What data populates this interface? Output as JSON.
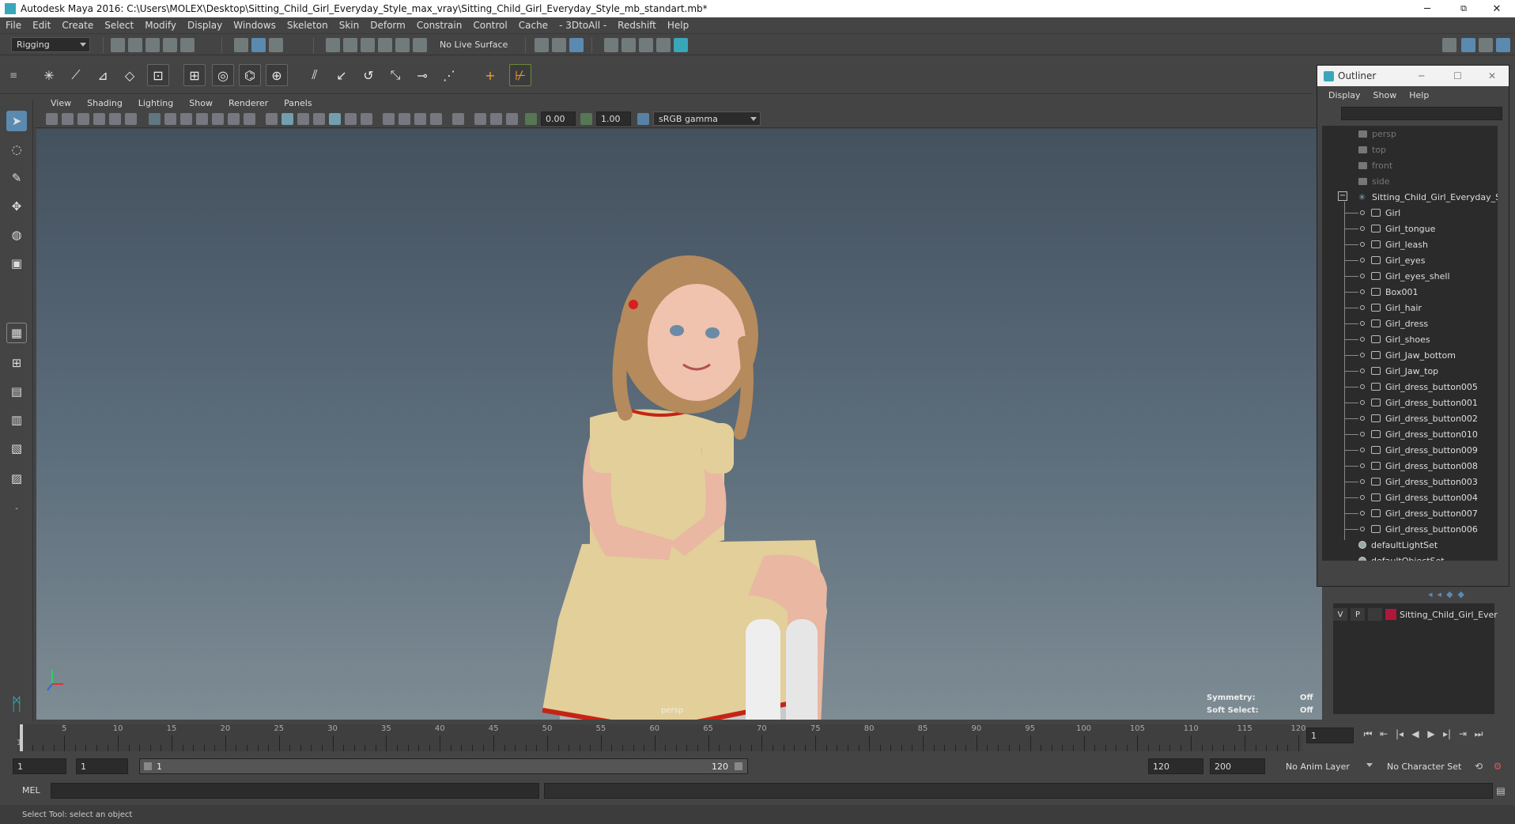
{
  "window": {
    "title": "Autodesk Maya 2016: C:\\Users\\MOLEX\\Desktop\\Sitting_Child_Girl_Everyday_Style_max_vray\\Sitting_Child_Girl_Everyday_Style_mb_standart.mb*",
    "controls": {
      "minimize": "─",
      "maximize": "⧉",
      "close": "✕"
    }
  },
  "menubar": {
    "items": [
      "File",
      "Edit",
      "Create",
      "Select",
      "Modify",
      "Display",
      "Windows",
      "Skeleton",
      "Skin",
      "Deform",
      "Constrain",
      "Control",
      "Cache",
      "- 3DtoAll -",
      "Redshift",
      "Help"
    ]
  },
  "statusline": {
    "menuset": "Rigging",
    "live_surface": "No Live Surface"
  },
  "viewport": {
    "panel_menu": [
      "View",
      "Shading",
      "Lighting",
      "Show",
      "Renderer",
      "Panels"
    ],
    "exposure": "0.00",
    "gamma": "1.00",
    "color_space": "sRGB gamma",
    "camera_label": "persp",
    "hud": {
      "symmetry_label": "Symmetry:",
      "symmetry_value": "Off",
      "soft_select_label": "Soft Select:",
      "soft_select_value": "Off"
    }
  },
  "outliner": {
    "title": "Outliner",
    "menu": [
      "Display",
      "Show",
      "Help"
    ],
    "items": [
      {
        "label": "persp",
        "kind": "camera",
        "dim": true,
        "level": 1
      },
      {
        "label": "top",
        "kind": "camera",
        "dim": true,
        "level": 1
      },
      {
        "label": "front",
        "kind": "camera",
        "dim": true,
        "level": 1
      },
      {
        "label": "side",
        "kind": "camera",
        "dim": true,
        "level": 1
      },
      {
        "label": "Sitting_Child_Girl_Everyday_Styl",
        "kind": "group",
        "dim": false,
        "level": 1
      },
      {
        "label": "Girl",
        "kind": "mesh",
        "dim": false,
        "level": 2
      },
      {
        "label": "Girl_tongue",
        "kind": "mesh",
        "dim": false,
        "level": 2
      },
      {
        "label": "Girl_leash",
        "kind": "mesh",
        "dim": false,
        "level": 2
      },
      {
        "label": "Girl_eyes",
        "kind": "mesh",
        "dim": false,
        "level": 2
      },
      {
        "label": "Girl_eyes_shell",
        "kind": "mesh",
        "dim": false,
        "level": 2
      },
      {
        "label": "Box001",
        "kind": "mesh",
        "dim": false,
        "level": 2
      },
      {
        "label": "Girl_hair",
        "kind": "mesh",
        "dim": false,
        "level": 2
      },
      {
        "label": "Girl_dress",
        "kind": "mesh",
        "dim": false,
        "level": 2
      },
      {
        "label": "Girl_shoes",
        "kind": "mesh",
        "dim": false,
        "level": 2
      },
      {
        "label": "Girl_Jaw_bottom",
        "kind": "mesh",
        "dim": false,
        "level": 2
      },
      {
        "label": "Girl_Jaw_top",
        "kind": "mesh",
        "dim": false,
        "level": 2
      },
      {
        "label": "Girl_dress_button005",
        "kind": "mesh",
        "dim": false,
        "level": 2
      },
      {
        "label": "Girl_dress_button001",
        "kind": "mesh",
        "dim": false,
        "level": 2
      },
      {
        "label": "Girl_dress_button002",
        "kind": "mesh",
        "dim": false,
        "level": 2
      },
      {
        "label": "Girl_dress_button010",
        "kind": "mesh",
        "dim": false,
        "level": 2
      },
      {
        "label": "Girl_dress_button009",
        "kind": "mesh",
        "dim": false,
        "level": 2
      },
      {
        "label": "Girl_dress_button008",
        "kind": "mesh",
        "dim": false,
        "level": 2
      },
      {
        "label": "Girl_dress_button003",
        "kind": "mesh",
        "dim": false,
        "level": 2
      },
      {
        "label": "Girl_dress_button004",
        "kind": "mesh",
        "dim": false,
        "level": 2
      },
      {
        "label": "Girl_dress_button007",
        "kind": "mesh",
        "dim": false,
        "level": 2
      },
      {
        "label": "Girl_dress_button006",
        "kind": "mesh",
        "dim": false,
        "level": 2
      },
      {
        "label": "defaultLightSet",
        "kind": "set",
        "dim": false,
        "level": 1
      },
      {
        "label": "defaultObjectSet",
        "kind": "set",
        "dim": false,
        "level": 1
      }
    ]
  },
  "layer_editor": {
    "v": "V",
    "p": "P",
    "layer_color": "#b0173c",
    "layer_name": "Sitting_Child_Girl_Ever"
  },
  "timeline": {
    "ticks": [
      5,
      10,
      15,
      20,
      25,
      30,
      35,
      40,
      45,
      50,
      55,
      60,
      65,
      70,
      75,
      80,
      85,
      90,
      95,
      100,
      105,
      110,
      115,
      120
    ],
    "start_label": "1",
    "current_frame": "1"
  },
  "range": {
    "start": "1",
    "anim_start": "1",
    "slider_start": "1",
    "slider_end": "120",
    "end": "120",
    "anim_end": "200",
    "anim_layer": "No Anim Layer",
    "character_set": "No Character Set"
  },
  "command": {
    "lang": "MEL"
  },
  "help_line": "Select Tool: select an object",
  "colors": {
    "accent": "#5b8ab0",
    "maya_teal": "#3aa6b9",
    "dress": "#e2cf9a",
    "dress_trim": "#c42416",
    "shoes": "#d81e1e"
  }
}
